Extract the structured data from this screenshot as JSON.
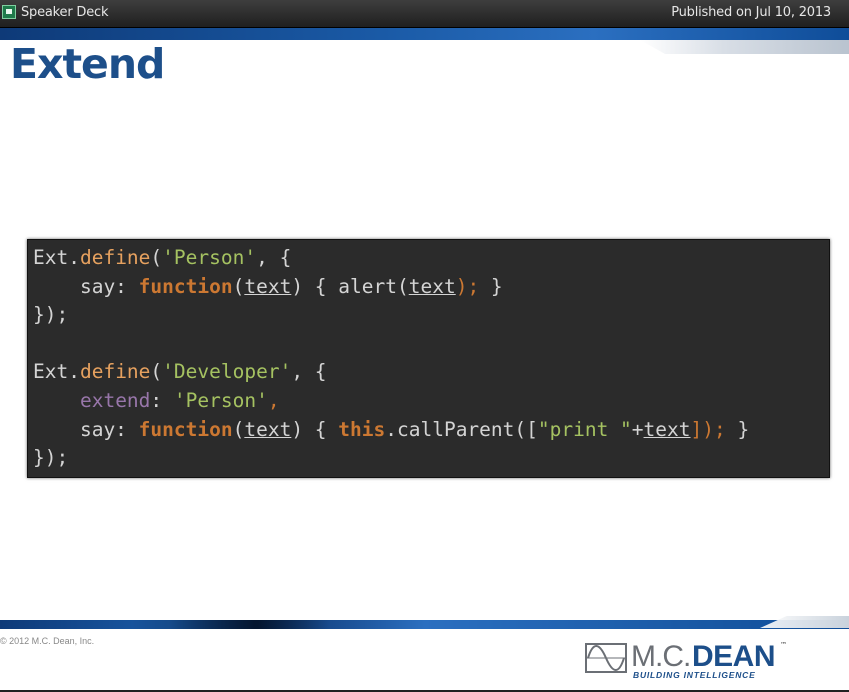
{
  "topbar": {
    "app_title": "Speaker Deck",
    "published": "Published on Jul 10, 2013"
  },
  "slide": {
    "title": "Extend",
    "code_lines": [
      [
        {
          "t": "Ext.",
          "c": "plain"
        },
        {
          "t": "define",
          "c": "call"
        },
        {
          "t": "(",
          "c": "plain"
        },
        {
          "t": "'Person'",
          "c": "str"
        },
        {
          "t": ", {",
          "c": "plain"
        }
      ],
      [
        {
          "t": "    say: ",
          "c": "plain"
        },
        {
          "t": "function",
          "c": "kw"
        },
        {
          "t": "(",
          "c": "plain"
        },
        {
          "t": "text",
          "c": "param"
        },
        {
          "t": ") { ",
          "c": "plain"
        },
        {
          "t": "alert",
          "c": "method"
        },
        {
          "t": "(",
          "c": "plain"
        },
        {
          "t": "text",
          "c": "param"
        },
        {
          "t": ");",
          "c": "punct"
        },
        {
          "t": " }",
          "c": "plain"
        }
      ],
      [
        {
          "t": "});",
          "c": "plain"
        }
      ],
      [
        {
          "t": "",
          "c": "plain"
        }
      ],
      [
        {
          "t": "Ext.",
          "c": "plain"
        },
        {
          "t": "define",
          "c": "call"
        },
        {
          "t": "(",
          "c": "plain"
        },
        {
          "t": "'Developer'",
          "c": "str"
        },
        {
          "t": ", {",
          "c": "plain"
        }
      ],
      [
        {
          "t": "    ",
          "c": "plain"
        },
        {
          "t": "extend",
          "c": "prop2"
        },
        {
          "t": ": ",
          "c": "plain"
        },
        {
          "t": "'Person'",
          "c": "str"
        },
        {
          "t": ",",
          "c": "punct"
        }
      ],
      [
        {
          "t": "    say: ",
          "c": "plain"
        },
        {
          "t": "function",
          "c": "kw"
        },
        {
          "t": "(",
          "c": "plain"
        },
        {
          "t": "text",
          "c": "param"
        },
        {
          "t": ") { ",
          "c": "plain"
        },
        {
          "t": "this",
          "c": "kw"
        },
        {
          "t": ".callParent([",
          "c": "plain"
        },
        {
          "t": "\"print \"",
          "c": "str"
        },
        {
          "t": "+",
          "c": "plain"
        },
        {
          "t": "text",
          "c": "param"
        },
        {
          "t": "]);",
          "c": "punct"
        },
        {
          "t": " }",
          "c": "plain"
        }
      ],
      [
        {
          "t": "});",
          "c": "plain"
        }
      ]
    ]
  },
  "footer": {
    "copyright": "© 2012 M.C. Dean, Inc.",
    "brand_mc": "M.C.",
    "brand_dean": "DEAN",
    "brand_tm": "™",
    "brand_tagline": "BUILDING INTELLIGENCE"
  },
  "colors": {
    "title_blue": "#1d4f8a",
    "code_bg": "#2b2b2b",
    "keyword": "#cc7832",
    "string": "#a5c261",
    "property": "#9876aa"
  }
}
